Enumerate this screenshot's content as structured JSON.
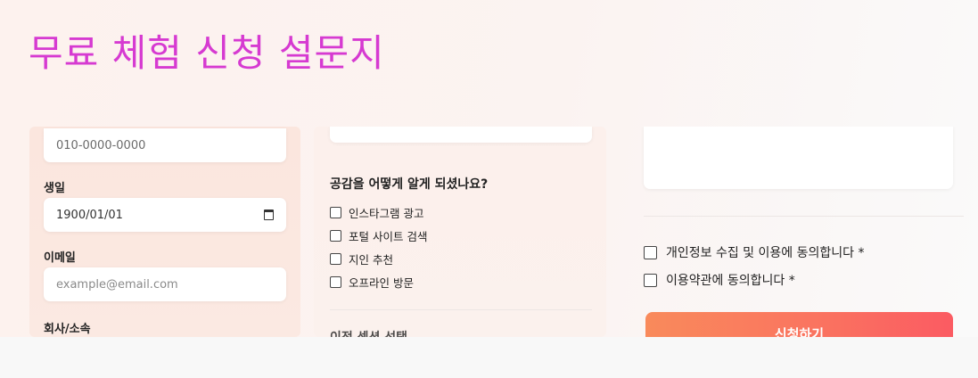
{
  "page": {
    "title": "무료 체험 신청 설문지"
  },
  "col1": {
    "phone_value": "010-0000-0000",
    "birthday_label": "생일",
    "birthday_value": "1900/01/01",
    "email_label": "이메일",
    "email_placeholder": "example@email.com",
    "company_label": "회사/소속"
  },
  "col2": {
    "question_label": "공감을 어떻게 알게 되셨나요?",
    "options": [
      "인스타그램 광고",
      "포털 사이트 검색",
      "지인 추천",
      "오프라인 방문"
    ],
    "next_section_label": "이전 섹션 선택"
  },
  "col3": {
    "agreements": [
      "개인정보 수집 및 이용에 동의합니다 *",
      "이용약관에 동의합니다 *"
    ],
    "submit_label": "신청하기"
  },
  "colors": {
    "title": "#d63ad1",
    "button_start": "#f98a5b",
    "button_end": "#fb5b62"
  },
  "icons": {
    "date_picker": "calendar-icon",
    "checkbox": "checkbox-icon"
  }
}
